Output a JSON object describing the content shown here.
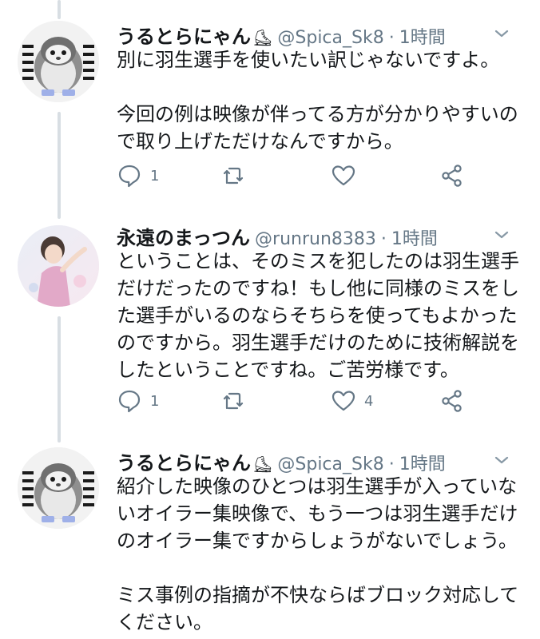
{
  "tweets": [
    {
      "name": "うるとらにゃん",
      "badge": "⛸",
      "handle": "@Spica_Sk8",
      "separator": "·",
      "time": "1時間",
      "text": "別に羽生選手を使いたい訳じゃないですよ。\n\n今回の例は映像が伴ってる方が分かりやすいの\nで取り上げただけなんですから。",
      "reply_count": "1",
      "retweet_count": "",
      "like_count": "",
      "avatar": "penguin-avatar"
    },
    {
      "name": "永遠のまっつん",
      "badge": "",
      "handle": "@runrun8383",
      "separator": "·",
      "time": "1時間",
      "text": "ということは、そのミスを犯したのは羽生選手\nだけだったのですね！もし他に同様のミスをし\nた選手がいるのならそちらを使ってもよかった\nのですから。羽生選手だけのために技術解説を\nしたということですね。ご苦労様です。",
      "reply_count": "1",
      "retweet_count": "",
      "like_count": "4",
      "avatar": "skater-avatar"
    },
    {
      "name": "うるとらにゃん",
      "badge": "⛸",
      "handle": "@Spica_Sk8",
      "separator": "·",
      "time": "1時間",
      "text": "紹介した映像のひとつは羽生選手が入っていな\nいオイラー集映像で、もう一つは羽生選手だけ\nのオイラー集ですからしょうがないでしょう。\n\nミス事例の指摘が不快ならばブロック対応して\nください。",
      "reply_count": "",
      "retweet_count": "",
      "like_count": "",
      "avatar": "penguin-avatar"
    }
  ],
  "colors": {
    "text": "#14171a",
    "muted": "#657786",
    "thread_line": "#d8dee3",
    "icon": "#657786"
  },
  "icons": [
    "reply-icon",
    "retweet-icon",
    "like-icon",
    "share-icon",
    "chevron-down-icon"
  ]
}
